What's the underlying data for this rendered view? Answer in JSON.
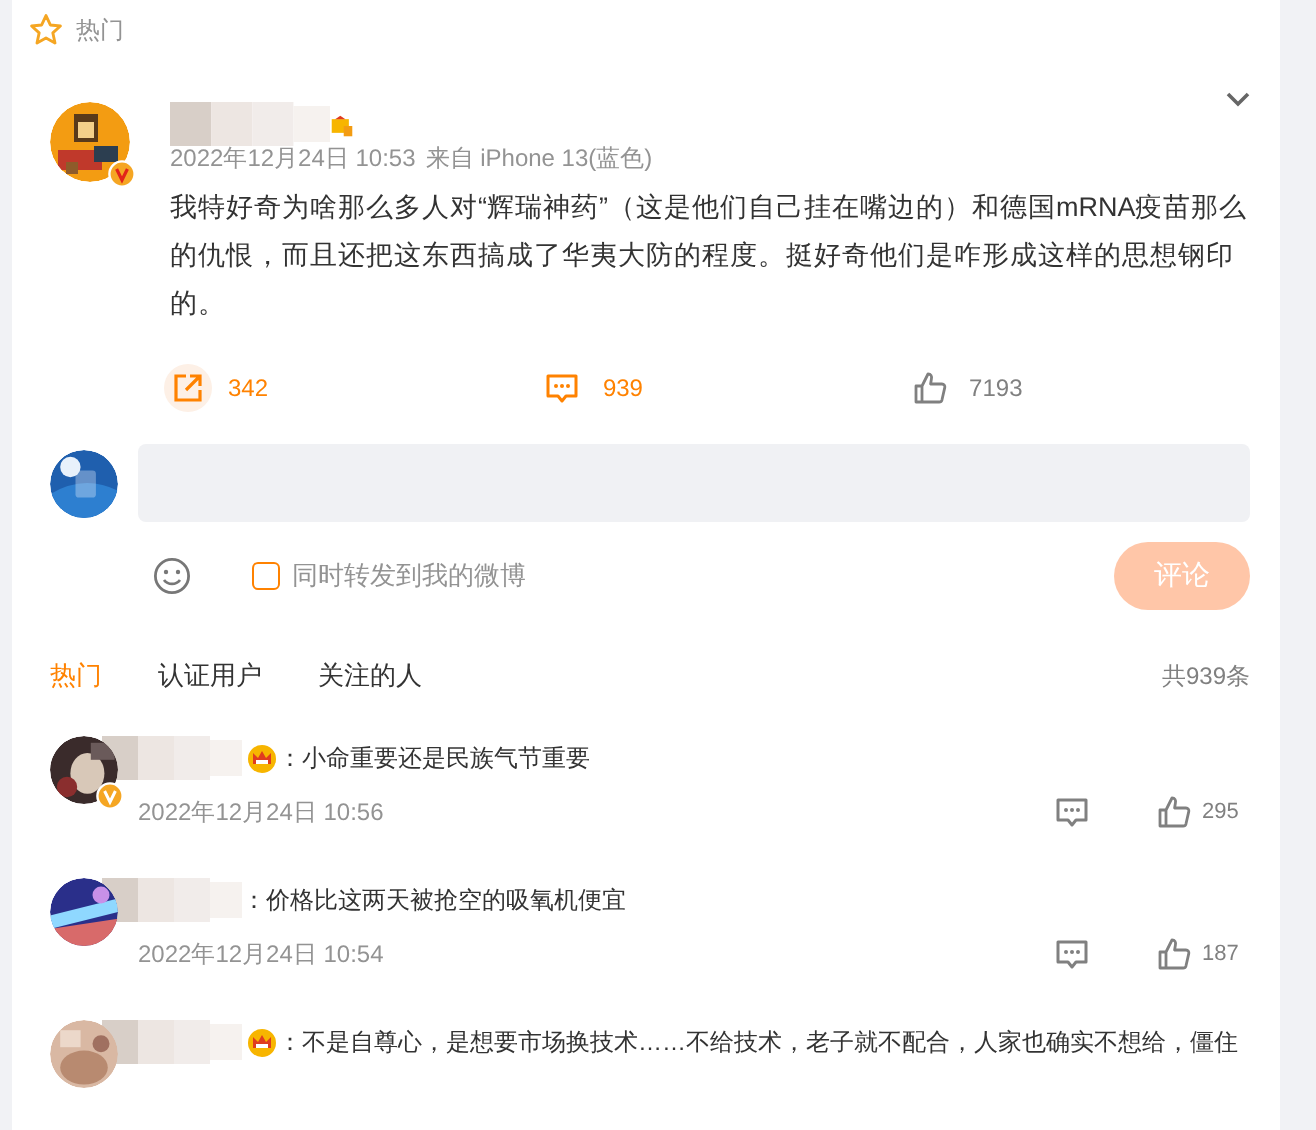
{
  "section": {
    "title": "热门"
  },
  "post": {
    "verified": true,
    "date": "2022年12月24日 10:53",
    "source": "来自 iPhone 13(蓝色)",
    "text": "我特好奇为啥那么多人对“辉瑞神药”（这是他们自己挂在嘴边的）和德国mRNA疫苗那么的仇恨，而且还把这东西搞成了华夷大防的程度。挺好奇他们是咋形成这样的思想钢印的。",
    "actions": [
      {
        "kind": "share",
        "count": "342",
        "active": true,
        "hovered": true
      },
      {
        "kind": "comment",
        "count": "939",
        "active": true,
        "hovered": false
      },
      {
        "kind": "like",
        "count": "7193",
        "active": false,
        "hovered": false
      }
    ]
  },
  "composer": {
    "repost_label": "同时转发到我的微博",
    "repost_checked": false,
    "submit": "评论",
    "submit_disabled": true
  },
  "tabs": [
    {
      "label": "热门",
      "selected": true
    },
    {
      "label": "认证用户",
      "selected": false
    },
    {
      "label": "关注的人",
      "selected": false
    }
  ],
  "total": "共939条",
  "comments": [
    {
      "verified": true,
      "crown": true,
      "text": "：小命重要还是民族气节重要",
      "date": "2022年12月24日 10:56",
      "likes": "295"
    },
    {
      "verified": false,
      "crown": false,
      "text": "：价格比这两天被抢空的吸氧机便宜",
      "date": "2022年12月24日 10:54",
      "likes": "187"
    },
    {
      "verified": false,
      "crown": true,
      "text": "：不是自尊心，是想要市场换技术……不给技术，老子就不配合，人家也确实不想给，僵住"
    }
  ]
}
